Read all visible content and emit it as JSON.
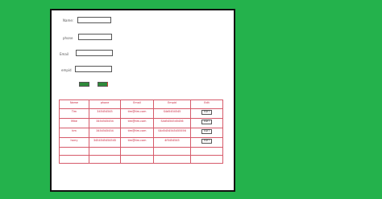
{
  "form": {
    "name_label": "Name:",
    "phone_label": "phone",
    "email_label": "Email",
    "empid_label": "empid",
    "name_value": "",
    "phone_value": "",
    "email_value": "",
    "empid_value": "",
    "save_label": "",
    "cancel_label": ""
  },
  "table": {
    "headers": [
      "Name",
      "phone",
      "Email",
      "Empid",
      "Edit"
    ],
    "rows": [
      {
        "name": "Tim",
        "phone": "345454545",
        "email": "tim@tim.com",
        "empid": "S4d5454545",
        "action": "EDIT"
      },
      {
        "name": "Mike",
        "phone": "3454545454",
        "email": "tim@tim.com",
        "empid": "S4d5454545456",
        "action": "EDIT"
      },
      {
        "name": "tim",
        "phone": "3454545454",
        "email": "tim@tim.com",
        "empid": "S4d5454545455556",
        "action": "EDIT"
      },
      {
        "name": "harry",
        "phone": "3454545454545",
        "email": "tim@tim.com",
        "empid": "4f5454545",
        "action": "EDIT"
      }
    ]
  }
}
